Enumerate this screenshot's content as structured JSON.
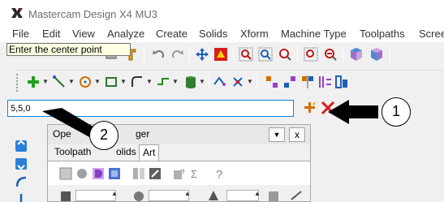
{
  "window": {
    "title": "Mastercam Design X4 MU3"
  },
  "menu": [
    "File",
    "Edit",
    "View",
    "Analyze",
    "Create",
    "Solids",
    "Xform",
    "Machine Type",
    "Toolpaths",
    "Scree"
  ],
  "tooltip": "Enter the center point",
  "coordinate_input": {
    "value": "5,5,0"
  },
  "callouts": {
    "one": "1",
    "two": "2"
  },
  "panel": {
    "title_visible": "Ope",
    "title_suffix_visible": "ger",
    "tabs": [
      "Toolpath",
      "olids",
      "Art"
    ],
    "menu_glyph": "▼",
    "close_glyph": "x"
  },
  "colors": {
    "accent": "#0a84d6",
    "tooltip_bg": "#ffffe1",
    "arrow": "#000000"
  },
  "icons": [
    "mastercam-logo-icon",
    "new-file-icon",
    "undo-icon",
    "redo-icon",
    "zoom-icon",
    "solid-icon",
    "line-icon",
    "circle-icon",
    "rectangle-icon",
    "spline-icon",
    "fillet-icon",
    "fast-point-icon",
    "autocursor-icon",
    "help-icon"
  ]
}
